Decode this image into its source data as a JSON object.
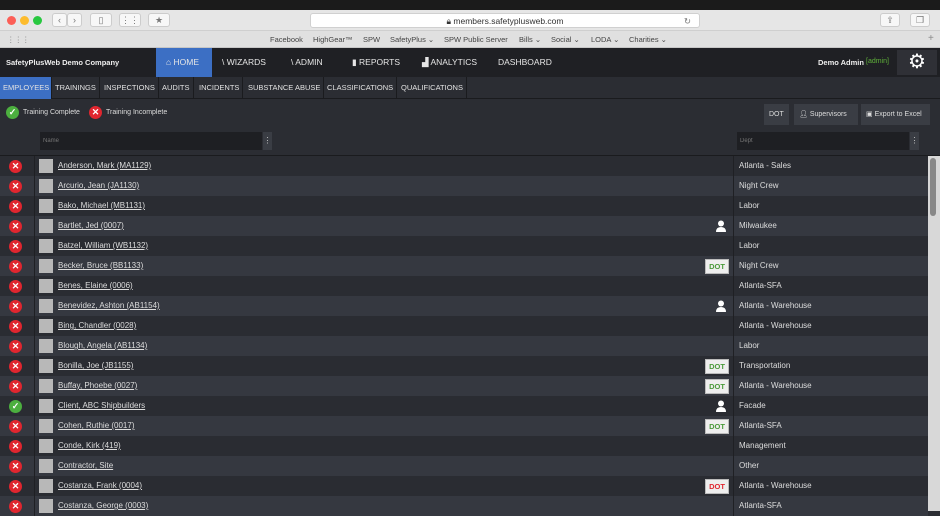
{
  "browser": {
    "url": "members.safetyplusweb.com",
    "bookmarks": [
      "Facebook",
      "HighGear™",
      "SPW",
      "SafetyPlus ⌄",
      "SPW Public Server",
      "Bills ⌄",
      "Social ⌄",
      "LODA ⌄",
      "Charities ⌄"
    ]
  },
  "app": {
    "company": "SafetyPlusWeb Demo Company",
    "user": "Demo Admin",
    "role": "[admin]",
    "nav": [
      "HOME",
      "WIZARDS",
      "ADMIN",
      "REPORTS",
      "ANALYTICS",
      "DASHBOARD"
    ],
    "subnav": [
      "EMPLOYEES",
      "TRAININGS",
      "INSPECTIONS",
      "AUDITS",
      "INCIDENTS",
      "SUBSTANCE ABUSE",
      "CLASSIFICATIONS",
      "QUALIFICATIONS"
    ]
  },
  "legend": {
    "complete": "Training Complete",
    "incomplete": "Training Incomplete"
  },
  "actions": {
    "dot": "DOT",
    "supervisors": "Supervisors",
    "export": "Export to Excel"
  },
  "filters": {
    "name_placeholder": "Name",
    "dept_placeholder": "Dept"
  },
  "colors": {
    "accent": "#3c6fc4",
    "complete": "#4caf3f",
    "incomplete": "#e0262f",
    "admin": "#5fb13a"
  },
  "employees": [
    {
      "name": "Anderson, Mark (MA1129)",
      "dept": "Atlanta - Sales",
      "status": "incomplete",
      "badge": ""
    },
    {
      "name": "Arcurio, Jean (JA1130)",
      "dept": "Night Crew",
      "status": "incomplete",
      "badge": ""
    },
    {
      "name": "Bako, Michael (MB1131)",
      "dept": "Labor",
      "status": "incomplete",
      "badge": ""
    },
    {
      "name": "Bartlet, Jed (0007)",
      "dept": "Milwaukee",
      "status": "incomplete",
      "badge": "supervisor"
    },
    {
      "name": "Batzel, William (WB1132)",
      "dept": "Labor",
      "status": "incomplete",
      "badge": ""
    },
    {
      "name": "Becker, Bruce (BB1133)",
      "dept": "Night Crew",
      "status": "incomplete",
      "badge": "DOT",
      "badge_color": "#4a9a3a"
    },
    {
      "name": "Benes, Elaine (0006)",
      "dept": "Atlanta-SFA",
      "status": "incomplete",
      "badge": ""
    },
    {
      "name": "Benevidez, Ashton (AB1154)",
      "dept": "Atlanta - Warehouse",
      "status": "incomplete",
      "badge": "supervisor"
    },
    {
      "name": "Bing, Chandler (0028)",
      "dept": "Atlanta - Warehouse",
      "status": "incomplete",
      "badge": ""
    },
    {
      "name": "Blough, Angela (AB1134)",
      "dept": "Labor",
      "status": "incomplete",
      "badge": ""
    },
    {
      "name": "Bonilla, Joe (JB1155)",
      "dept": "Transportation",
      "status": "incomplete",
      "badge": "DOT",
      "badge_color": "#4a9a3a"
    },
    {
      "name": "Buffay, Phoebe (0027)",
      "dept": "Atlanta - Warehouse",
      "status": "incomplete",
      "badge": "DOT",
      "badge_color": "#4a9a3a"
    },
    {
      "name": "Client, ABC Shipbuilders",
      "dept": "Facade",
      "status": "complete",
      "badge": "supervisor"
    },
    {
      "name": "Cohen, Ruthie (0017)",
      "dept": "Atlanta-SFA",
      "status": "incomplete",
      "badge": "DOT",
      "badge_color": "#4a9a3a"
    },
    {
      "name": "Conde, Kirk (419)",
      "dept": "Management",
      "status": "incomplete",
      "badge": ""
    },
    {
      "name": "Contractor, Site",
      "dept": "Other",
      "status": "incomplete",
      "badge": ""
    },
    {
      "name": "Costanza, Frank (0004)",
      "dept": "Atlanta - Warehouse",
      "status": "incomplete",
      "badge": "DOT",
      "badge_color": "#e0262f"
    },
    {
      "name": "Costanza, George (0003)",
      "dept": "Atlanta-SFA",
      "status": "incomplete",
      "badge": ""
    }
  ]
}
